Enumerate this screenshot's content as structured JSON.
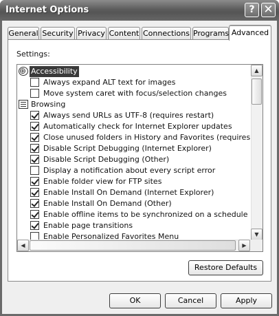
{
  "window": {
    "title": "Internet Options"
  },
  "titlebar": {
    "help_glyph": "?",
    "close_glyph": "✕"
  },
  "tabs": [
    {
      "label": "General",
      "active": false
    },
    {
      "label": "Security",
      "active": false
    },
    {
      "label": "Privacy",
      "active": false
    },
    {
      "label": "Content",
      "active": false
    },
    {
      "label": "Connections",
      "active": false
    },
    {
      "label": "Programs",
      "active": false
    },
    {
      "label": "Advanced",
      "active": true
    }
  ],
  "settings": {
    "label": "Settings:",
    "rows": [
      {
        "type": "group",
        "icon": "accessibility-icon",
        "label": "Accessibility",
        "highlighted": true
      },
      {
        "type": "option",
        "checked": false,
        "label": "Always expand ALT text for images"
      },
      {
        "type": "option",
        "checked": false,
        "label": "Move system caret with focus/selection changes"
      },
      {
        "type": "group",
        "icon": "browsing-icon",
        "label": "Browsing",
        "highlighted": false
      },
      {
        "type": "option",
        "checked": true,
        "label": "Always send URLs as UTF-8 (requires restart)"
      },
      {
        "type": "option",
        "checked": true,
        "label": "Automatically check for Internet Explorer updates"
      },
      {
        "type": "option",
        "checked": true,
        "label": "Close unused folders in History and Favorites (requires restart)"
      },
      {
        "type": "option",
        "checked": true,
        "label": "Disable Script Debugging (Internet Explorer)"
      },
      {
        "type": "option",
        "checked": true,
        "label": "Disable Script Debugging (Other)"
      },
      {
        "type": "option",
        "checked": false,
        "label": "Display a notification about every script error"
      },
      {
        "type": "option",
        "checked": true,
        "label": "Enable folder view for FTP sites"
      },
      {
        "type": "option",
        "checked": true,
        "label": "Enable Install On Demand (Internet Explorer)"
      },
      {
        "type": "option",
        "checked": true,
        "label": "Enable Install On Demand (Other)"
      },
      {
        "type": "option",
        "checked": true,
        "label": "Enable offline items to be synchronized on a schedule"
      },
      {
        "type": "option",
        "checked": true,
        "label": "Enable page transitions"
      },
      {
        "type": "option",
        "checked": false,
        "label": "Enable Personalized Favorites Menu"
      }
    ]
  },
  "scroll": {
    "up": "▲",
    "down": "▼",
    "left": "◀",
    "right": "▶"
  },
  "buttons": {
    "restore_defaults": "Restore Defaults",
    "ok": "OK",
    "cancel": "Cancel",
    "apply": "Apply"
  }
}
